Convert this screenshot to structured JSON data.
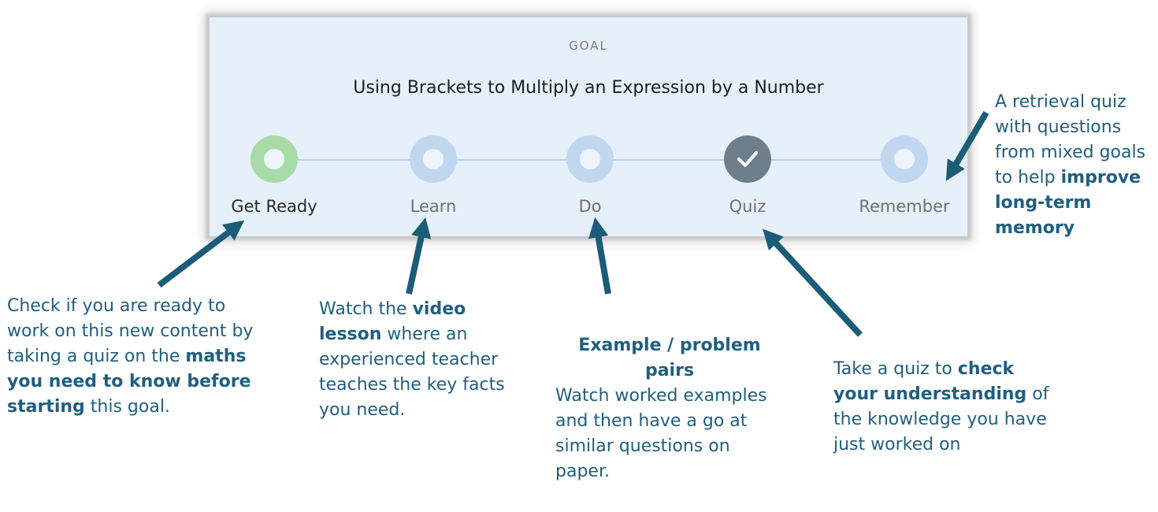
{
  "card": {
    "label": "GOAL",
    "title": "Using Brackets to Multiply an Expression by a Number"
  },
  "steps": [
    {
      "label": "Get Ready",
      "state": "ready"
    },
    {
      "label": "Learn",
      "state": "pending"
    },
    {
      "label": "Do",
      "state": "pending"
    },
    {
      "label": "Quiz",
      "state": "complete"
    },
    {
      "label": "Remember",
      "state": "pending"
    }
  ],
  "notes": {
    "get_ready": {
      "t1": "Check if you are ready to work on this new content by taking a quiz on the ",
      "b1": "maths you need to know before starting",
      "t2": " this goal."
    },
    "learn": {
      "t1": "Watch the ",
      "b1": "video lesson",
      "t2": " where an experienced teacher teaches the key facts you need."
    },
    "do": {
      "heading": "Example / problem pairs",
      "body": "Watch worked examples and then have a go at similar questions on paper."
    },
    "quiz": {
      "t1": "Take a quiz to ",
      "b1": "check your understanding",
      "t2": " of the knowledge you have just worked on"
    },
    "remember": {
      "t1": "A retrieval quiz with questions from mixed goals to help ",
      "b1": "improve long-term memory"
    }
  },
  "colors": {
    "annotation": "#1f5f80",
    "arrow": "#1b5c78",
    "ready_ring": "#a7dba7",
    "pending_ring": "#c1d6ef",
    "complete_fill": "#6e7f8b"
  }
}
